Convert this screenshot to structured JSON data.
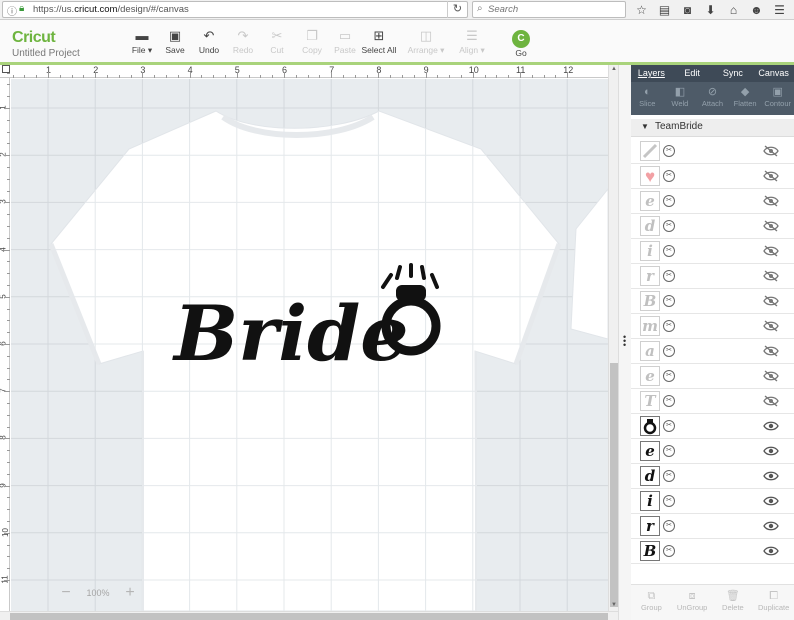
{
  "browser": {
    "url_prefix": "https://us.",
    "url_domain": "cricut.com",
    "url_path": "/design/#/canvas",
    "search_placeholder": "Search"
  },
  "app": {
    "logo_text": "ricut",
    "logo_letter": "C",
    "project_name": "Untitled Project"
  },
  "toolbar": {
    "items": [
      {
        "label": "File ▾",
        "icon": "folder-icon",
        "enabled": true
      },
      {
        "label": "Save",
        "icon": "save-icon",
        "enabled": true
      },
      {
        "label": "Undo",
        "icon": "undo-icon",
        "enabled": true
      },
      {
        "label": "Redo",
        "icon": "redo-icon",
        "enabled": false
      },
      {
        "label": "Cut",
        "icon": "cut-icon",
        "enabled": false
      },
      {
        "label": "Copy",
        "icon": "copy-icon",
        "enabled": false
      },
      {
        "label": "Paste",
        "icon": "paste-icon",
        "enabled": false
      },
      {
        "label": "Select All",
        "icon": "select-all-icon",
        "enabled": true
      },
      {
        "label": "Arrange ▾",
        "icon": "arrange-icon",
        "enabled": false
      },
      {
        "label": "Align ▾",
        "icon": "align-icon",
        "enabled": false
      }
    ],
    "go_label": "Go",
    "go_letter": "C"
  },
  "rulers": {
    "top": [
      "1",
      "2",
      "3",
      "4",
      "5",
      "6",
      "7",
      "8",
      "9",
      "10",
      "11",
      "12"
    ],
    "left": [
      "1",
      "2",
      "3",
      "4",
      "5",
      "6",
      "7",
      "8",
      "9",
      "10",
      "11"
    ]
  },
  "canvas": {
    "design_text": "Bride",
    "zoom_minus": "−",
    "zoom_level": "100%",
    "zoom_plus": "+",
    "colors": {
      "background": "#e8ecef",
      "shirt": "#ffffff",
      "ink": "#111111"
    }
  },
  "panel": {
    "tabs": [
      "Layers",
      "Edit",
      "Sync",
      "Canvas"
    ],
    "active_tab": "Layers",
    "tools": [
      {
        "label": "Slice",
        "icon": "slice-icon"
      },
      {
        "label": "Weld",
        "icon": "weld-icon"
      },
      {
        "label": "Attach",
        "icon": "attach-icon"
      },
      {
        "label": "Flatten",
        "icon": "flatten-icon"
      },
      {
        "label": "Contour",
        "icon": "contour-icon"
      }
    ],
    "group_name": "TeamBride",
    "layers": [
      {
        "glyph": "",
        "thumb": "line",
        "visible": false
      },
      {
        "glyph": "",
        "thumb": "heart",
        "visible": false
      },
      {
        "glyph": "e",
        "thumb": "letter",
        "visible": false
      },
      {
        "glyph": "d",
        "thumb": "letter",
        "visible": false
      },
      {
        "glyph": "i",
        "thumb": "letter",
        "visible": false
      },
      {
        "glyph": "r",
        "thumb": "letter",
        "visible": false
      },
      {
        "glyph": "B",
        "thumb": "letter",
        "visible": false
      },
      {
        "glyph": "m",
        "thumb": "letter",
        "visible": false
      },
      {
        "glyph": "a",
        "thumb": "letter",
        "visible": false
      },
      {
        "glyph": "e",
        "thumb": "letter",
        "visible": false
      },
      {
        "glyph": "T",
        "thumb": "letter",
        "visible": false
      },
      {
        "glyph": "",
        "thumb": "ring",
        "visible": true
      },
      {
        "glyph": "e",
        "thumb": "letter",
        "visible": true
      },
      {
        "glyph": "d",
        "thumb": "letter",
        "visible": true
      },
      {
        "glyph": "i",
        "thumb": "letter",
        "visible": true
      },
      {
        "glyph": "r",
        "thumb": "letter",
        "visible": true
      },
      {
        "glyph": "B",
        "thumb": "letter",
        "visible": true
      }
    ],
    "footer": [
      {
        "label": "Group",
        "icon": "group-icon"
      },
      {
        "label": "UnGroup",
        "icon": "ungroup-icon"
      },
      {
        "label": "Delete",
        "icon": "trash-icon"
      },
      {
        "label": "Duplicate",
        "icon": "duplicate-icon"
      }
    ]
  }
}
